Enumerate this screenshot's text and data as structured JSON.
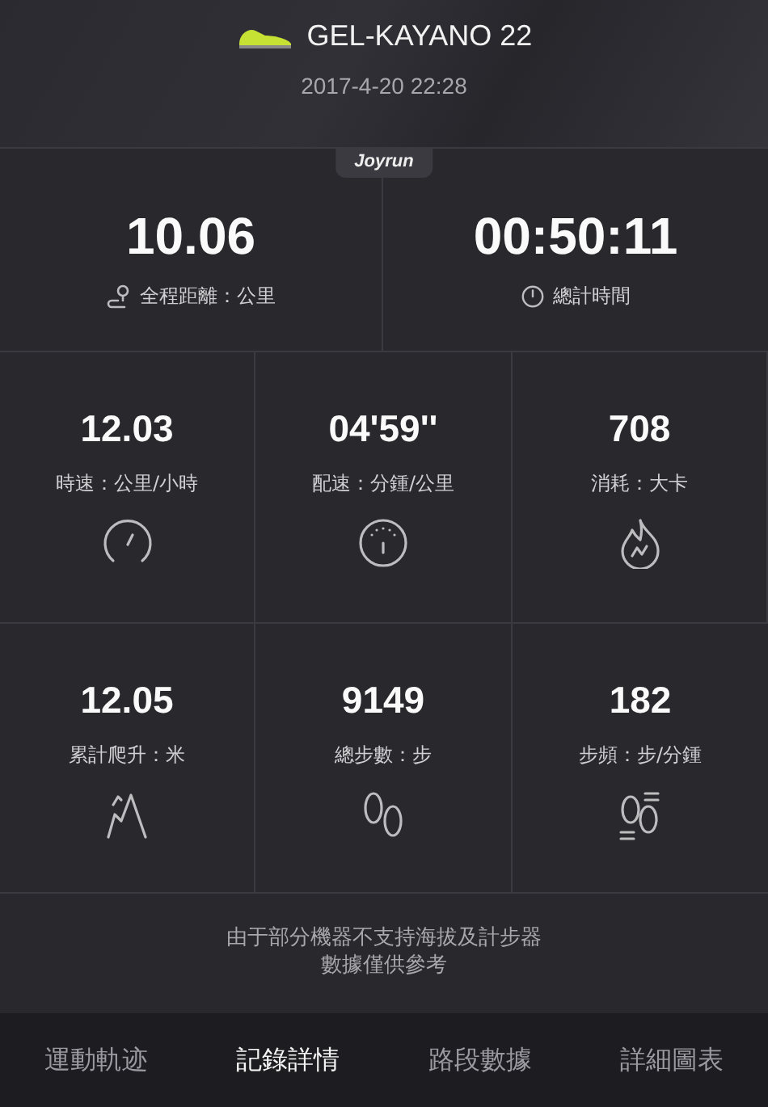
{
  "header": {
    "shoe": "GEL-KAYANO 22",
    "date": "2017-4-20 22:28",
    "badge": "Joyrun"
  },
  "main_stats": [
    {
      "value": "10.06",
      "label": "全程距離：公里",
      "kind": "route"
    },
    {
      "value": "00:50:11",
      "label": "總計時間",
      "kind": "timer"
    }
  ],
  "stats": [
    {
      "value": "12.03",
      "label": "時速：公里/小時",
      "kind": "speed"
    },
    {
      "value": "04'59''",
      "label": "配速：分鍾/公里",
      "kind": "pace"
    },
    {
      "value": "708",
      "label": "消耗：大卡",
      "kind": "calories"
    },
    {
      "value": "12.05",
      "label": "累計爬升：米",
      "kind": "climb"
    },
    {
      "value": "9149",
      "label": "總步數：步",
      "kind": "steps"
    },
    {
      "value": "182",
      "label": "步頻：步/分鍾",
      "kind": "cadence"
    }
  ],
  "note": [
    "由于部分機器不支持海拔及計步器",
    "數據僅供參考"
  ],
  "tabs": [
    {
      "label": "運動軌迹",
      "selected": false
    },
    {
      "label": "記錄詳情",
      "selected": true
    },
    {
      "label": "路段數據",
      "selected": false
    },
    {
      "label": "詳細圖表",
      "selected": false
    }
  ]
}
